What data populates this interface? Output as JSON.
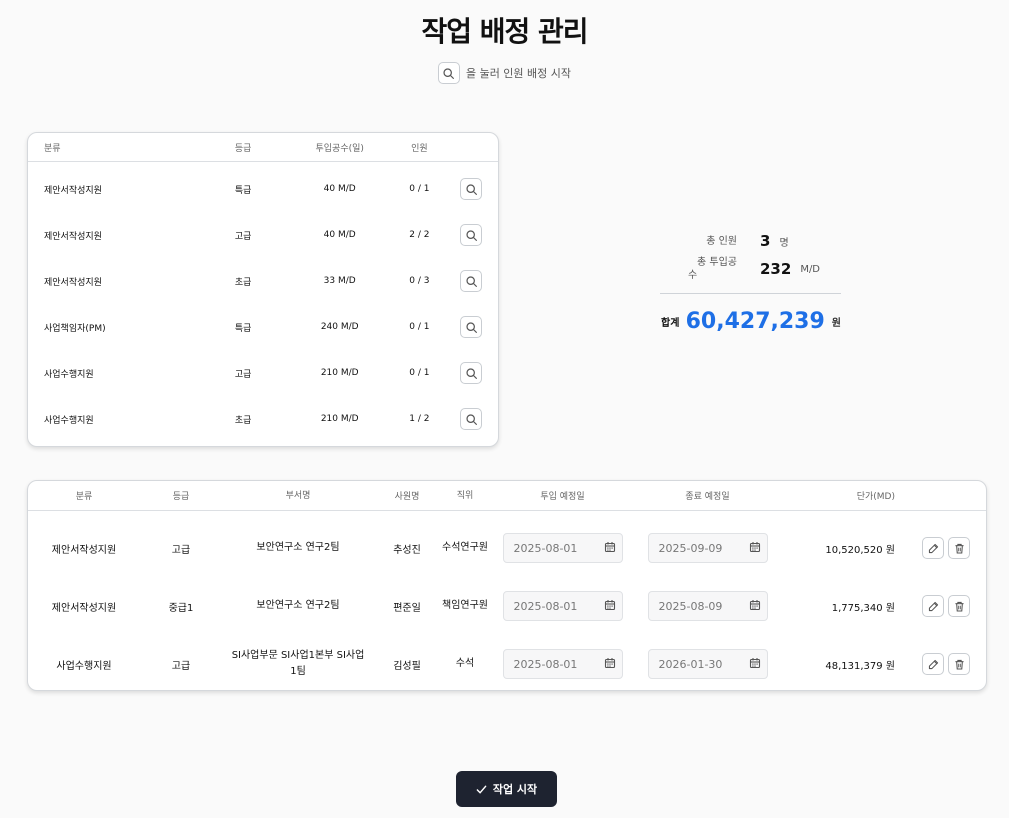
{
  "page": {
    "title": "작업 배정 관리",
    "hint": "을 눌러 인원 배정 시작"
  },
  "requirements": {
    "headers": [
      "분류",
      "등급",
      "투입공수(일)",
      "인원"
    ],
    "rows": [
      {
        "category": "제안서작성지원",
        "grade": "특급",
        "effort": "40 M/D",
        "people": "0 / 1"
      },
      {
        "category": "제안서작성지원",
        "grade": "고급",
        "effort": "40 M/D",
        "people": "2 / 2"
      },
      {
        "category": "제안서작성지원",
        "grade": "초급",
        "effort": "33 M/D",
        "people": "0 / 3"
      },
      {
        "category": "사업책임자(PM)",
        "grade": "특급",
        "effort": "240 M/D",
        "people": "0 / 1"
      },
      {
        "category": "사업수행지원",
        "grade": "고급",
        "effort": "210 M/D",
        "people": "0 / 1"
      },
      {
        "category": "사업수행지원",
        "grade": "초급",
        "effort": "210 M/D",
        "people": "1 / 2"
      }
    ]
  },
  "summary": {
    "total_people_label": "총 인원",
    "total_people_value": "3",
    "total_people_unit": "명",
    "total_effort_label_1": "총 투입공",
    "total_effort_label_2": "수",
    "total_effort_value": "232",
    "total_effort_unit": "M/D",
    "total_label": "합계",
    "total_value": "60,427,239",
    "total_unit": "원",
    "accent_color": "#1e6fe6"
  },
  "assignments": {
    "headers": [
      "분류",
      "등급",
      "부서명",
      "사원명",
      "직위",
      "투입 예정일",
      "종료 예정일",
      "단가(MD)"
    ],
    "rows": [
      {
        "category": "제안서작성지원",
        "grade": "고급",
        "dept": "보안연구소 연구2팀",
        "name": "추성진",
        "position": "수석연구원",
        "start": "2025-08-01",
        "end": "2025-09-09",
        "price": "10,520,520 원"
      },
      {
        "category": "제안서작성지원",
        "grade": "중급1",
        "dept": "보안연구소 연구2팀",
        "name": "편준일",
        "position": "책임연구원",
        "start": "2025-08-01",
        "end": "2025-08-09",
        "price": "1,775,340 원"
      },
      {
        "category": "사업수행지원",
        "grade": "고급",
        "dept": "SI사업부문 SI사업1본부 SI사업1팀",
        "name": "김성필",
        "position": "수석",
        "start": "2025-08-01",
        "end": "2026-01-30",
        "price": "48,131,379 원"
      }
    ]
  },
  "actions": {
    "start_label": "작업 시작"
  },
  "icons": {
    "search": "search-icon",
    "calendar": "calendar-icon",
    "edit": "edit-icon",
    "delete": "trash-icon",
    "check": "check-icon"
  }
}
